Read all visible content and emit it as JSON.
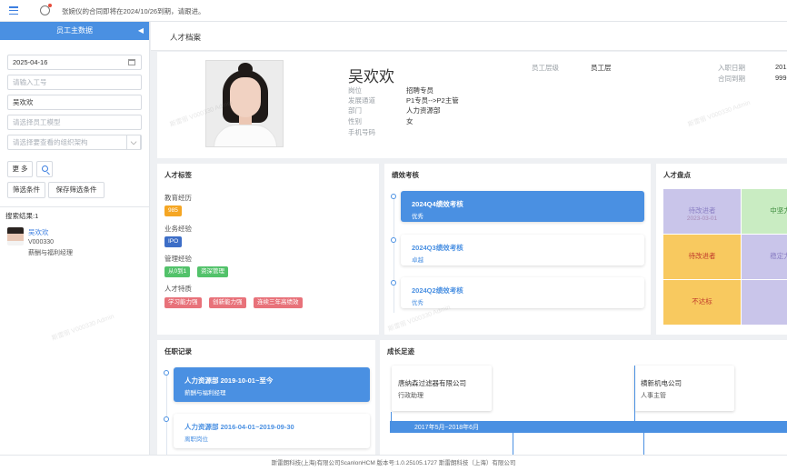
{
  "topbar": {
    "notice": "张婉仪的合同即将在2024/10/26到期，请跟进。"
  },
  "left_panel": {
    "title": "员工主数据",
    "date_value": "2025-04-16",
    "emp_no_placeholder": "请输入工号",
    "name_value": "吴欢欢",
    "status_placeholder": "请选择员工模型",
    "org_placeholder": "请选择要查看的组织架构",
    "more_label": "更 多",
    "filter_label": "筛选条件",
    "save_filter_label": "保存筛选条件",
    "result_title": "搜索结果:1",
    "result": {
      "name": "吴欢欢",
      "id": "V000330",
      "dept": "薪酬与福利经理"
    }
  },
  "page": {
    "title": "人才档案"
  },
  "profile": {
    "name": "吴欢欢",
    "left_fields": [
      {
        "label": "岗位",
        "value": "招聘专员"
      },
      {
        "label": "发展通道",
        "value": "P1专员-->P2主管"
      },
      {
        "label": "部门",
        "value": "人力资源部"
      },
      {
        "label": "性别",
        "value": "女"
      },
      {
        "label": "手机号码",
        "value": ""
      }
    ],
    "mid_label": "员工层级",
    "mid_value": "员工层",
    "right_fields": [
      {
        "label": "入职日期",
        "value": "201"
      },
      {
        "label": "合同到期",
        "value": "999"
      }
    ]
  },
  "talent_tags": {
    "title": "人才标签",
    "groups": [
      {
        "name": "教育经历",
        "tags": [
          {
            "text": "985",
            "color": "#f5a623"
          }
        ]
      },
      {
        "name": "业务经验",
        "tags": [
          {
            "text": "IPO",
            "color": "#3d6ec7"
          }
        ]
      },
      {
        "name": "管理经验",
        "tags": [
          {
            "text": "从0到1",
            "color": "#52c26a"
          },
          {
            "text": "资深管理",
            "color": "#52c26a"
          }
        ]
      },
      {
        "name": "人才特质",
        "tags": [
          {
            "text": "学习能力强",
            "color": "#e8727a"
          },
          {
            "text": "创新能力强",
            "color": "#e8727a"
          },
          {
            "text": "连续三年高绩效",
            "color": "#e8727a"
          }
        ]
      }
    ]
  },
  "performance": {
    "title": "绩效考核",
    "items": [
      {
        "title": "2024Q4绩效考核",
        "result": "优秀",
        "active": true
      },
      {
        "title": "2024Q3绩效考核",
        "result": "卓越",
        "active": false
      },
      {
        "title": "2024Q2绩效考核",
        "result": "优秀",
        "active": false
      }
    ]
  },
  "inventory": {
    "title": "人才盘点",
    "cells": [
      {
        "label": "待改进者",
        "sub": "2023-03-01",
        "color": "#c9c5ea",
        "text_color": "#8a7fc4"
      },
      {
        "label": "中坚力",
        "sub": "",
        "color": "#c9ecc2",
        "text_color": "#3d8b3d"
      },
      {
        "label": "待改进者",
        "sub": "",
        "color": "#f8c95f",
        "text_color": "#c0392b"
      },
      {
        "label": "稳定力",
        "sub": "",
        "color": "#c9c5ea",
        "text_color": "#8a7fc4"
      },
      {
        "label": "不达标",
        "sub": "",
        "color": "#f8c95f",
        "text_color": "#c0392b"
      },
      {
        "label": "",
        "sub": "",
        "color": "#c9c5ea",
        "text_color": "#8a7fc4"
      }
    ]
  },
  "career": {
    "title": "任职记录",
    "items": [
      {
        "title": "人力资源部  2019-10-01~至今",
        "sub": "薪酬与福利经理",
        "active": true
      },
      {
        "title": "人力资源部  2016-04-01~2019-09-30",
        "sub": "离职岗位",
        "active": false
      }
    ]
  },
  "growth": {
    "title": "成长足迹",
    "boxes": [
      {
        "company": "唐纳森过滤器有限公司",
        "role": "行政助理"
      },
      {
        "company": "横新机电公司",
        "role": "人事主管"
      }
    ],
    "period": "2017年5月~2018年6月"
  },
  "watermark": "斯雷丽 V000330 Admin",
  "footer": "斯雷朗科技(上海)有限公司ScanlonHCM 版本号:1.0.25105.1727 斯雷朗科技（上海）有限公司"
}
